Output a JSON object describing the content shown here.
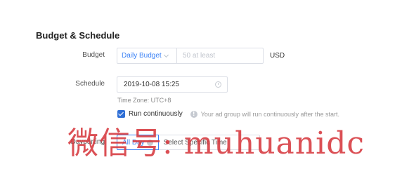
{
  "section": {
    "title": "Budget & Schedule"
  },
  "budget": {
    "label": "Budget",
    "type_value": "Daily Budget",
    "amount_placeholder": "50 at least",
    "currency": "USD"
  },
  "schedule": {
    "label": "Schedule",
    "start_datetime": "2019-10-08 15:25",
    "timezone": "Time Zone: UTC+8",
    "run_continuously": {
      "checked": true,
      "label": "Run continuously"
    },
    "note": "Your ad group will run continuously after the start."
  },
  "dayparting": {
    "label": "Dayparting",
    "options": [
      {
        "label": "All Day",
        "selected": true
      },
      {
        "label": "Select Specific Time",
        "selected": false
      }
    ]
  },
  "watermark": {
    "text": "微信号: muhuanidc"
  },
  "colors": {
    "accent": "#3b82f6",
    "checkbox": "#2f6fd6",
    "watermark": "#d6383e"
  },
  "icons": [
    "chevron-down-icon",
    "clock-icon",
    "info-icon",
    "check-icon"
  ]
}
